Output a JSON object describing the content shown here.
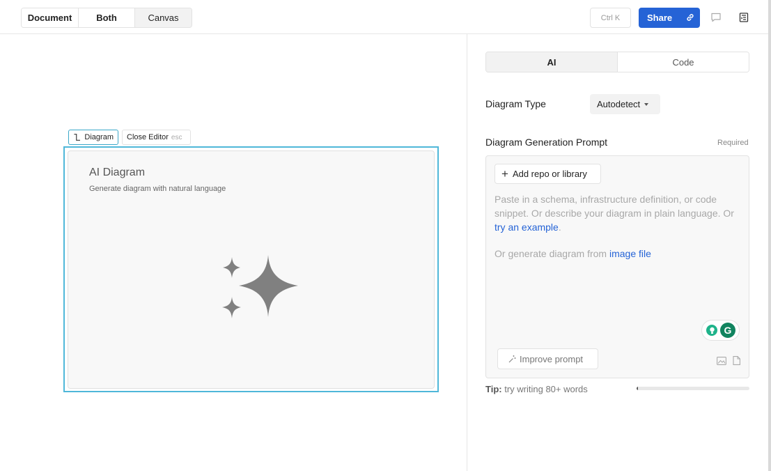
{
  "topbar": {
    "view_modes": [
      "Document",
      "Both",
      "Canvas"
    ],
    "selected_view": "Canvas",
    "shortcut": "Ctrl K",
    "share_label": "Share",
    "icons": [
      "link-icon",
      "comment-icon",
      "panel-toggle-icon"
    ],
    "accent_color": "#2563d6"
  },
  "canvas": {
    "diagram_chip": "Diagram",
    "close_editor": "Close Editor",
    "close_editor_key": "esc",
    "card_title": "AI Diagram",
    "card_subtitle": "Generate diagram with natural language",
    "selection_color": "#4fb7d9"
  },
  "panel": {
    "tabs": [
      "AI",
      "Code"
    ],
    "active_tab": "AI",
    "diagram_type_label": "Diagram Type",
    "diagram_type_value": "Autodetect",
    "prompt_label": "Diagram Generation Prompt",
    "required": "Required",
    "add_repo": "Add repo or library",
    "placeholder_pre": "Paste in a schema, infrastructure definition, or code snippet. Or describe your diagram in plain language. Or ",
    "placeholder_link": "try an example",
    "placeholder_post": ".",
    "image_pre": "Or generate diagram from ",
    "image_link": "image file",
    "improve": "Improve prompt",
    "tip_label": "Tip:",
    "tip_text": "try writing 80+ words",
    "word_progress": 0.01
  }
}
